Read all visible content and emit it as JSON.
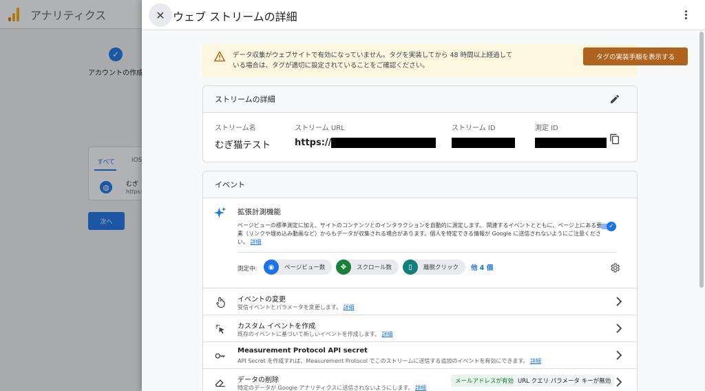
{
  "background": {
    "app_title": "アナリティクス",
    "step_label": "アカウントの作成",
    "tab_all": "すべて",
    "tab_ios": "iOS",
    "row_name": "むぎ",
    "row_url": "https:",
    "next_button": "次へ"
  },
  "panel": {
    "title": "ウェブ ストリームの詳細"
  },
  "warning": {
    "text": "データ収集がウェブサイトで有効になっていません。タグを実装してから 48 時間以上経過している場合は、タグが適切に設定されていることをご確認ください。",
    "button_label": "タグの実装手順を表示する"
  },
  "stream_details": {
    "heading": "ストリームの詳細",
    "name_label": "ストリーム名",
    "name_value": "むぎ猫テスト",
    "url_label": "ストリーム URL",
    "url_value": "https://",
    "stream_id_label": "ストリーム ID",
    "measurement_id_label": "測定 ID"
  },
  "events": {
    "heading": "イベント",
    "enhanced": {
      "title": "拡張計測機能",
      "description": "ページビューの標準測定に加え、サイトのコンテンツとのインタラクションを自動的に測定します。 関連するイベントとともに、ページ上にある要素（リンクや埋め込み動画など）からもデータが収集される場合があります。個人を特定できる情報が Google に送信されないようにご注意ください。",
      "details_link": "詳細",
      "measuring_label": "測定中:",
      "chips": [
        {
          "label": "ページビュー数",
          "color": "#1a73e8"
        },
        {
          "label": "スクロール数",
          "color": "#188038"
        },
        {
          "label": "離脱クリック",
          "color": "#12807a"
        }
      ],
      "more": "他 4 個"
    },
    "rows": [
      {
        "title": "イベントの変更",
        "sub": "受信イベントとパラメータを変更します。",
        "link": "詳細"
      },
      {
        "title": "カスタム イベントを作成",
        "sub": "既存のイベントに基づいて新しいイベントを作成します。",
        "link": "詳細"
      },
      {
        "title": "Measurement Protocol API secret",
        "sub": "API Secret を作成すれば、Measurement Protocol でこのストリームに送信する追加のイベントを有効にできます。",
        "link": "詳細"
      },
      {
        "title": "データの削除",
        "sub": "特定のデータが Google アナリティクスに送信されないようにします。",
        "link": "詳細",
        "badge_green": "メールアドレスが有効",
        "badge_grey": "URL クエリ パラメータ キーが無効"
      }
    ]
  }
}
